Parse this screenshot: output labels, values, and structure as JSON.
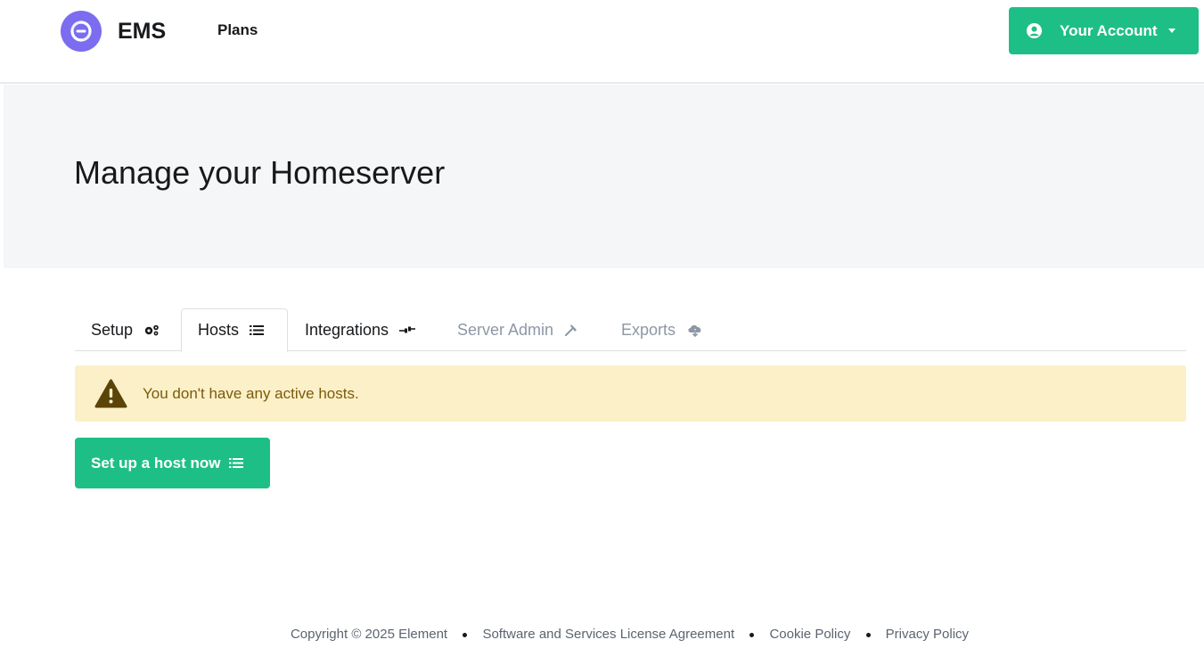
{
  "navbar": {
    "brand": "EMS",
    "plans_label": "Plans",
    "account_label": "Your Account"
  },
  "hero": {
    "title": "Manage your Homeserver"
  },
  "tabs": [
    {
      "label": "Setup",
      "icon": "gears-icon",
      "state": "normal"
    },
    {
      "label": "Hosts",
      "icon": "list-icon",
      "state": "active"
    },
    {
      "label": "Integrations",
      "icon": "plug-icon",
      "state": "normal"
    },
    {
      "label": "Server Admin",
      "icon": "hammer-icon",
      "state": "disabled"
    },
    {
      "label": "Exports",
      "icon": "cloud-download-icon",
      "state": "disabled"
    }
  ],
  "alert": {
    "message": "You don't have any active hosts.",
    "icon": "warning-icon"
  },
  "setup_button": {
    "label": "Set up a host now",
    "icon": "list-icon"
  },
  "footer": {
    "copyright": "Copyright © 2025 Element",
    "links": [
      "Software and Services License Agreement",
      "Cookie Policy",
      "Privacy Policy"
    ]
  },
  "colors": {
    "accent": "#1ebf87",
    "brand_logo": "#7c6cf0",
    "hero_bg": "#f5f6f8",
    "alert_bg": "#fcf0c9",
    "alert_text": "#7a5b0c",
    "disabled_tab": "#8d97a5"
  }
}
